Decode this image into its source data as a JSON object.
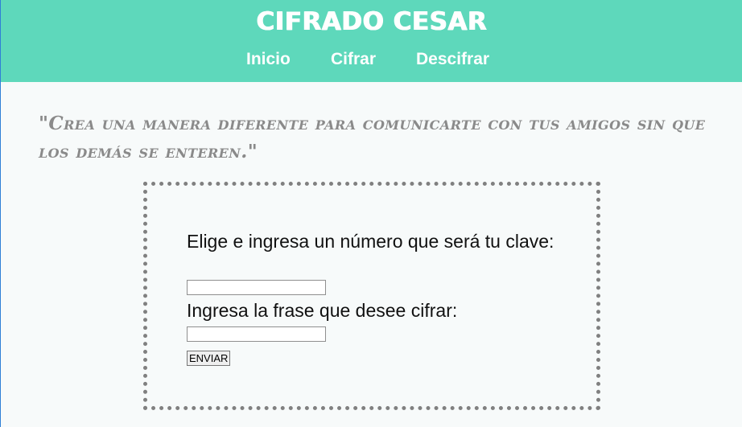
{
  "header": {
    "title": "CIFRADO CESAR",
    "nav": [
      {
        "label": "Inicio"
      },
      {
        "label": "Cifrar"
      },
      {
        "label": "Descifrar"
      }
    ],
    "background_color": "#5ed8bb"
  },
  "quote": {
    "text": "\"Crea una manera diferente para comunicarte con tus amigos sin que los demás se enteren.\""
  },
  "form": {
    "key_label": "Elige e ingresa un número que será tu clave:",
    "key_value": "",
    "phrase_label": "Ingresa la frase que desee cifrar:",
    "phrase_value": "",
    "submit_label": "ENVIAR"
  }
}
